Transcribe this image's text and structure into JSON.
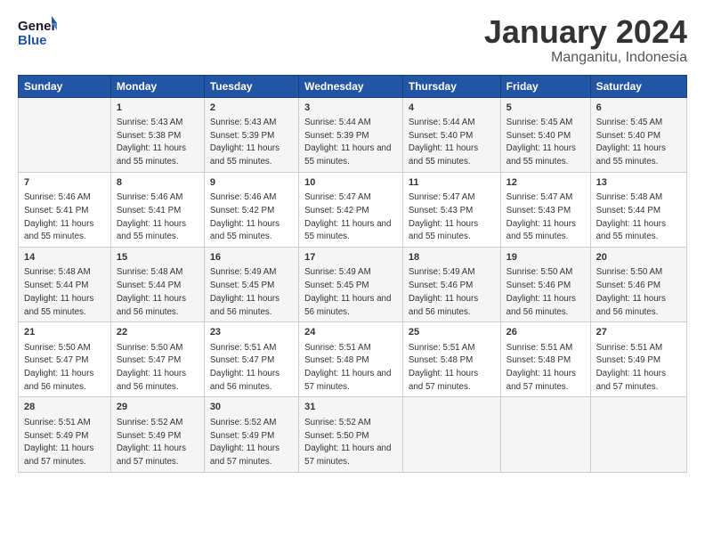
{
  "logo": {
    "general": "General",
    "blue": "Blue"
  },
  "title": "January 2024",
  "subtitle": "Manganitu, Indonesia",
  "days": [
    "Sunday",
    "Monday",
    "Tuesday",
    "Wednesday",
    "Thursday",
    "Friday",
    "Saturday"
  ],
  "weeks": [
    [
      {
        "day": "",
        "sunrise": "",
        "sunset": "",
        "daylight": ""
      },
      {
        "day": "1",
        "sunrise": "Sunrise: 5:43 AM",
        "sunset": "Sunset: 5:38 PM",
        "daylight": "Daylight: 11 hours and 55 minutes."
      },
      {
        "day": "2",
        "sunrise": "Sunrise: 5:43 AM",
        "sunset": "Sunset: 5:39 PM",
        "daylight": "Daylight: 11 hours and 55 minutes."
      },
      {
        "day": "3",
        "sunrise": "Sunrise: 5:44 AM",
        "sunset": "Sunset: 5:39 PM",
        "daylight": "Daylight: 11 hours and 55 minutes."
      },
      {
        "day": "4",
        "sunrise": "Sunrise: 5:44 AM",
        "sunset": "Sunset: 5:40 PM",
        "daylight": "Daylight: 11 hours and 55 minutes."
      },
      {
        "day": "5",
        "sunrise": "Sunrise: 5:45 AM",
        "sunset": "Sunset: 5:40 PM",
        "daylight": "Daylight: 11 hours and 55 minutes."
      },
      {
        "day": "6",
        "sunrise": "Sunrise: 5:45 AM",
        "sunset": "Sunset: 5:40 PM",
        "daylight": "Daylight: 11 hours and 55 minutes."
      }
    ],
    [
      {
        "day": "7",
        "sunrise": "Sunrise: 5:46 AM",
        "sunset": "Sunset: 5:41 PM",
        "daylight": "Daylight: 11 hours and 55 minutes."
      },
      {
        "day": "8",
        "sunrise": "Sunrise: 5:46 AM",
        "sunset": "Sunset: 5:41 PM",
        "daylight": "Daylight: 11 hours and 55 minutes."
      },
      {
        "day": "9",
        "sunrise": "Sunrise: 5:46 AM",
        "sunset": "Sunset: 5:42 PM",
        "daylight": "Daylight: 11 hours and 55 minutes."
      },
      {
        "day": "10",
        "sunrise": "Sunrise: 5:47 AM",
        "sunset": "Sunset: 5:42 PM",
        "daylight": "Daylight: 11 hours and 55 minutes."
      },
      {
        "day": "11",
        "sunrise": "Sunrise: 5:47 AM",
        "sunset": "Sunset: 5:43 PM",
        "daylight": "Daylight: 11 hours and 55 minutes."
      },
      {
        "day": "12",
        "sunrise": "Sunrise: 5:47 AM",
        "sunset": "Sunset: 5:43 PM",
        "daylight": "Daylight: 11 hours and 55 minutes."
      },
      {
        "day": "13",
        "sunrise": "Sunrise: 5:48 AM",
        "sunset": "Sunset: 5:44 PM",
        "daylight": "Daylight: 11 hours and 55 minutes."
      }
    ],
    [
      {
        "day": "14",
        "sunrise": "Sunrise: 5:48 AM",
        "sunset": "Sunset: 5:44 PM",
        "daylight": "Daylight: 11 hours and 55 minutes."
      },
      {
        "day": "15",
        "sunrise": "Sunrise: 5:48 AM",
        "sunset": "Sunset: 5:44 PM",
        "daylight": "Daylight: 11 hours and 56 minutes."
      },
      {
        "day": "16",
        "sunrise": "Sunrise: 5:49 AM",
        "sunset": "Sunset: 5:45 PM",
        "daylight": "Daylight: 11 hours and 56 minutes."
      },
      {
        "day": "17",
        "sunrise": "Sunrise: 5:49 AM",
        "sunset": "Sunset: 5:45 PM",
        "daylight": "Daylight: 11 hours and 56 minutes."
      },
      {
        "day": "18",
        "sunrise": "Sunrise: 5:49 AM",
        "sunset": "Sunset: 5:46 PM",
        "daylight": "Daylight: 11 hours and 56 minutes."
      },
      {
        "day": "19",
        "sunrise": "Sunrise: 5:50 AM",
        "sunset": "Sunset: 5:46 PM",
        "daylight": "Daylight: 11 hours and 56 minutes."
      },
      {
        "day": "20",
        "sunrise": "Sunrise: 5:50 AM",
        "sunset": "Sunset: 5:46 PM",
        "daylight": "Daylight: 11 hours and 56 minutes."
      }
    ],
    [
      {
        "day": "21",
        "sunrise": "Sunrise: 5:50 AM",
        "sunset": "Sunset: 5:47 PM",
        "daylight": "Daylight: 11 hours and 56 minutes."
      },
      {
        "day": "22",
        "sunrise": "Sunrise: 5:50 AM",
        "sunset": "Sunset: 5:47 PM",
        "daylight": "Daylight: 11 hours and 56 minutes."
      },
      {
        "day": "23",
        "sunrise": "Sunrise: 5:51 AM",
        "sunset": "Sunset: 5:47 PM",
        "daylight": "Daylight: 11 hours and 56 minutes."
      },
      {
        "day": "24",
        "sunrise": "Sunrise: 5:51 AM",
        "sunset": "Sunset: 5:48 PM",
        "daylight": "Daylight: 11 hours and 57 minutes."
      },
      {
        "day": "25",
        "sunrise": "Sunrise: 5:51 AM",
        "sunset": "Sunset: 5:48 PM",
        "daylight": "Daylight: 11 hours and 57 minutes."
      },
      {
        "day": "26",
        "sunrise": "Sunrise: 5:51 AM",
        "sunset": "Sunset: 5:48 PM",
        "daylight": "Daylight: 11 hours and 57 minutes."
      },
      {
        "day": "27",
        "sunrise": "Sunrise: 5:51 AM",
        "sunset": "Sunset: 5:49 PM",
        "daylight": "Daylight: 11 hours and 57 minutes."
      }
    ],
    [
      {
        "day": "28",
        "sunrise": "Sunrise: 5:51 AM",
        "sunset": "Sunset: 5:49 PM",
        "daylight": "Daylight: 11 hours and 57 minutes."
      },
      {
        "day": "29",
        "sunrise": "Sunrise: 5:52 AM",
        "sunset": "Sunset: 5:49 PM",
        "daylight": "Daylight: 11 hours and 57 minutes."
      },
      {
        "day": "30",
        "sunrise": "Sunrise: 5:52 AM",
        "sunset": "Sunset: 5:49 PM",
        "daylight": "Daylight: 11 hours and 57 minutes."
      },
      {
        "day": "31",
        "sunrise": "Sunrise: 5:52 AM",
        "sunset": "Sunset: 5:50 PM",
        "daylight": "Daylight: 11 hours and 57 minutes."
      },
      {
        "day": "",
        "sunrise": "",
        "sunset": "",
        "daylight": ""
      },
      {
        "day": "",
        "sunrise": "",
        "sunset": "",
        "daylight": ""
      },
      {
        "day": "",
        "sunrise": "",
        "sunset": "",
        "daylight": ""
      }
    ]
  ]
}
